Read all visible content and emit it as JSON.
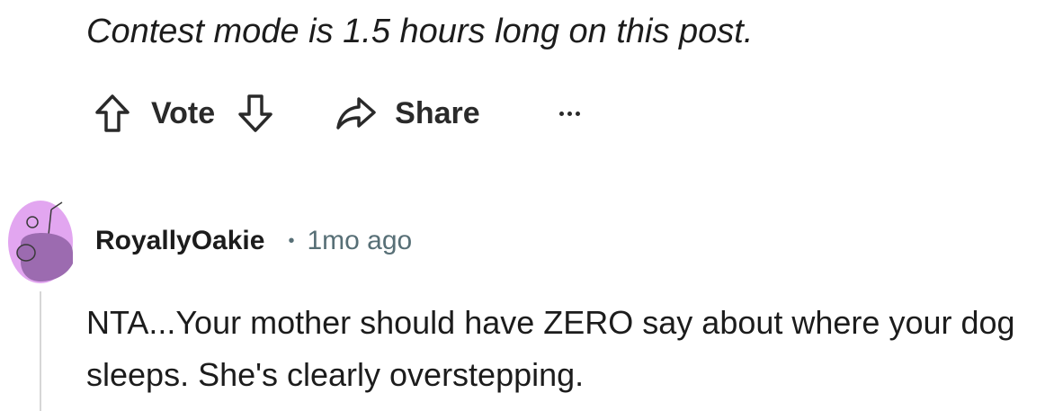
{
  "post": {
    "contest_note": "Contest mode is 1.5 hours long on this post."
  },
  "actions": {
    "vote_label": "Vote",
    "share_label": "Share",
    "upvote_icon": "arrow-up-outline-icon",
    "downvote_icon": "arrow-down-outline-icon",
    "share_icon": "share-arrow-icon",
    "more_icon": "ellipsis-icon"
  },
  "comment": {
    "author": "RoyallyOakie",
    "separator": "•",
    "timestamp": "1mo ago",
    "body": "NTA...Your mother should have ZERO say about where your dog sleeps. She's clearly overstepping.",
    "avatar_icon": "snoo-avatar-icon",
    "avatar_color": "#e2a6f0"
  }
}
